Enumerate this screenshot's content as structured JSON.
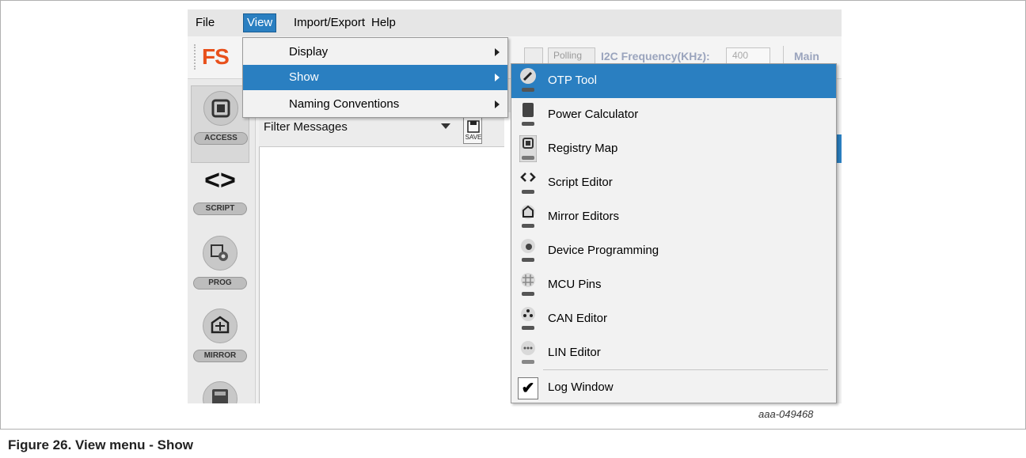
{
  "menubar": {
    "items": [
      {
        "label": "File"
      },
      {
        "label": "View",
        "active": true
      },
      {
        "label": "Import/Export"
      },
      {
        "label": "Help"
      }
    ]
  },
  "toolbar": {
    "logo": "FS",
    "polling_label": "Polling",
    "freq_label": "I2C Frequency(KHz):",
    "freq_value": "400",
    "main_label": "Main"
  },
  "sidebar": {
    "items": [
      {
        "label": "ACCESS",
        "icon": "access-chip-icon",
        "selected": true
      },
      {
        "label": "SCRIPT",
        "icon": "code-brackets-icon"
      },
      {
        "label": "PROG",
        "icon": "programming-gear-icon"
      },
      {
        "label": "MIRROR",
        "icon": "mirror-icon"
      },
      {
        "label": "",
        "icon": "calculator-icon"
      }
    ]
  },
  "log_panel": {
    "filter_label": "Filter Messages",
    "save_label": "SAVE"
  },
  "view_menu": {
    "items": [
      {
        "label": "Display",
        "has_submenu": true
      },
      {
        "label": "Show",
        "has_submenu": true,
        "highlighted": true
      },
      {
        "label": "Naming Conventions",
        "has_submenu": true
      }
    ]
  },
  "show_submenu": {
    "items": [
      {
        "label": "OTP Tool",
        "icon": "otp-tool-icon",
        "highlighted": true
      },
      {
        "label": "Power Calculator",
        "icon": "power-calculator-icon"
      },
      {
        "label": "Registry Map",
        "icon": "registry-map-icon"
      },
      {
        "label": "Script Editor",
        "icon": "script-editor-icon"
      },
      {
        "label": "Mirror Editors",
        "icon": "mirror-editors-icon"
      },
      {
        "label": "Device Programming",
        "icon": "device-programming-icon"
      },
      {
        "label": "MCU Pins",
        "icon": "mcu-pins-icon"
      },
      {
        "label": "CAN Editor",
        "icon": "can-editor-icon"
      },
      {
        "label": "LIN Editor",
        "icon": "lin-editor-icon"
      },
      {
        "label": "Log Window",
        "icon": "checkmark-icon",
        "checked": true,
        "check_glyph": "✔"
      }
    ]
  },
  "figure": {
    "id": "aaa-049468",
    "caption": "Figure 26.  View menu - Show"
  }
}
